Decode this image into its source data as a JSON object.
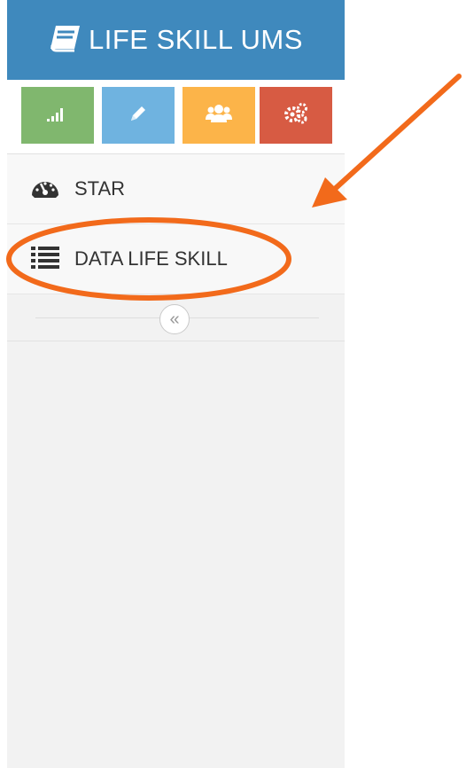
{
  "header": {
    "title": "LIFE SKILL UMS",
    "icon": "book-icon",
    "color": "#3f89bd"
  },
  "shortcuts": [
    {
      "icon": "signal-icon",
      "color": "#80b76e"
    },
    {
      "icon": "pencil-icon",
      "color": "#6fb3e0"
    },
    {
      "icon": "users-icon",
      "color": "#fcb449"
    },
    {
      "icon": "cogs-icon",
      "color": "#d75b43"
    }
  ],
  "menu": [
    {
      "label": "STAR",
      "icon": "dashboard-icon"
    },
    {
      "label": "DATA LIFE SKILL",
      "icon": "list-icon"
    }
  ],
  "collapse": {
    "icon": "double-chevron-left-icon",
    "glyph": "«"
  },
  "annotation": {
    "color": "#f26a1b",
    "shapes": [
      "arrow",
      "ellipse"
    ]
  }
}
